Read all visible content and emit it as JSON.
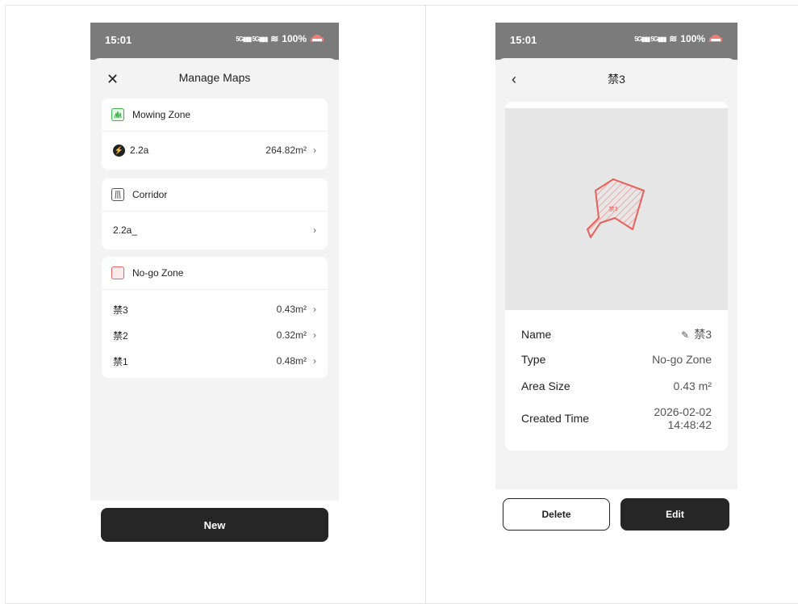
{
  "left_screen": {
    "status": {
      "time": "15:01",
      "network": "5G 5G",
      "battery": "100%"
    },
    "title": "Manage Maps",
    "sections": [
      {
        "label": "Mowing Zone",
        "items": [
          {
            "name": "2.2a",
            "value": "264.82m²",
            "icon": "bolt-icon"
          }
        ]
      },
      {
        "label": "Corridor",
        "items": [
          {
            "name": "2.2a_",
            "value": ""
          }
        ]
      },
      {
        "label": "No-go Zone",
        "items": [
          {
            "name": "禁3",
            "value": "0.43m²"
          },
          {
            "name": "禁2",
            "value": "0.32m²"
          },
          {
            "name": "禁1",
            "value": "0.48m²"
          }
        ]
      }
    ],
    "new_button": "New"
  },
  "right_screen": {
    "status": {
      "time": "15:01",
      "network": "5G 5G",
      "battery": "100%"
    },
    "title": "禁3",
    "map_label": "禁3",
    "details": {
      "name_label": "Name",
      "name_value": "禁3",
      "type_label": "Type",
      "type_value": "No-go Zone",
      "area_label": "Area Size",
      "area_value": "0.43 m²",
      "created_label": "Created Time",
      "created_date": "2026-02-02",
      "created_time": "14:48:42"
    },
    "delete_button": "Delete",
    "edit_button": "Edit"
  },
  "colors": {
    "mowing_zone": "#3cb44a",
    "no_go_zone": "#e8605a",
    "button_dark": "#262626"
  }
}
